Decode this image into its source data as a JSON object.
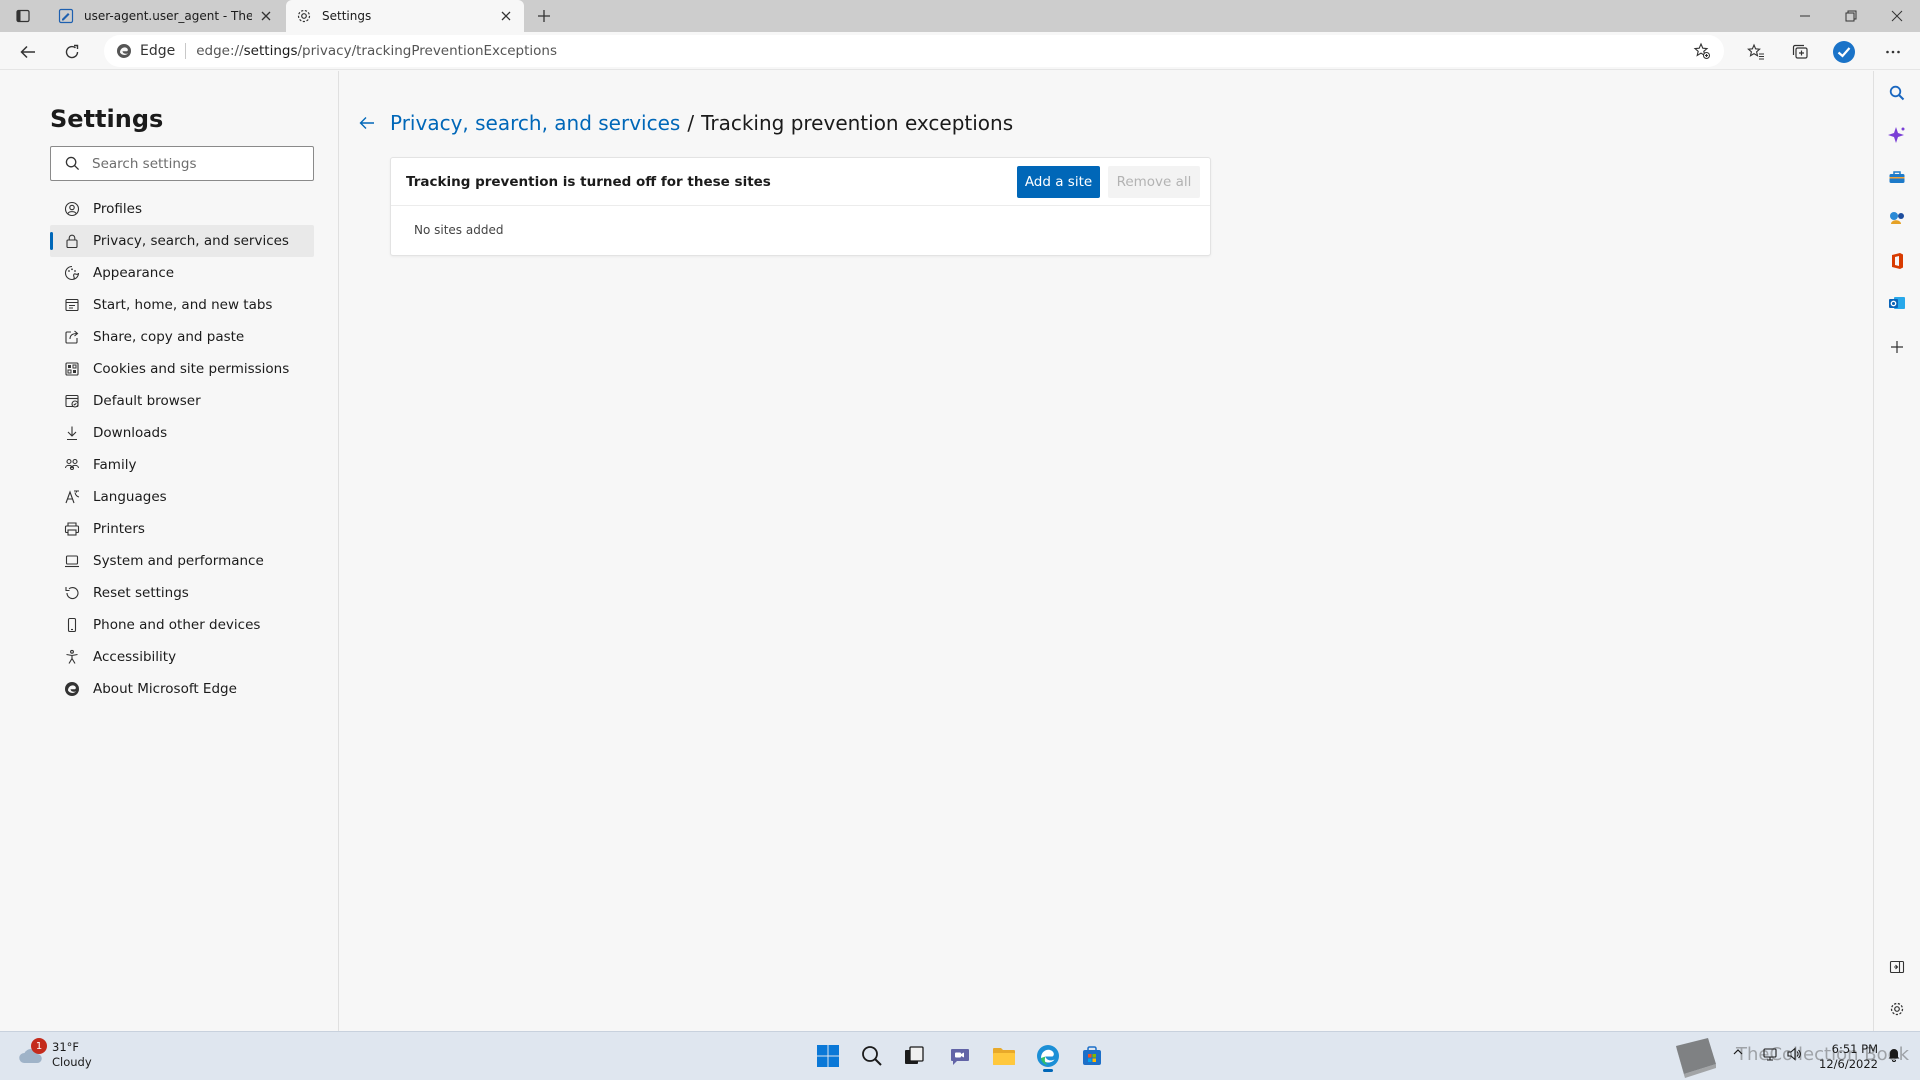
{
  "tabs": [
    {
      "title": "user-agent.user_agent - The Coll",
      "favicon": "edit-page-icon"
    },
    {
      "title": "Settings",
      "favicon": "gear-icon"
    }
  ],
  "toolbar": {
    "site_label": "Edge",
    "url_prefix": "edge://",
    "url_host": "settings",
    "url_path": "/privacy/trackingPreventionExceptions"
  },
  "sidebar": {
    "title": "Settings",
    "search_placeholder": "Search settings",
    "items": [
      {
        "label": "Profiles",
        "icon": "profile-icon"
      },
      {
        "label": "Privacy, search, and services",
        "icon": "lock-icon"
      },
      {
        "label": "Appearance",
        "icon": "appearance-icon"
      },
      {
        "label": "Start, home, and new tabs",
        "icon": "home-icon"
      },
      {
        "label": "Share, copy and paste",
        "icon": "share-icon"
      },
      {
        "label": "Cookies and site permissions",
        "icon": "cookies-icon"
      },
      {
        "label": "Default browser",
        "icon": "browser-icon"
      },
      {
        "label": "Downloads",
        "icon": "download-icon"
      },
      {
        "label": "Family",
        "icon": "family-icon"
      },
      {
        "label": "Languages",
        "icon": "language-icon"
      },
      {
        "label": "Printers",
        "icon": "printer-icon"
      },
      {
        "label": "System and performance",
        "icon": "laptop-icon"
      },
      {
        "label": "Reset settings",
        "icon": "reset-icon"
      },
      {
        "label": "Phone and other devices",
        "icon": "phone-icon"
      },
      {
        "label": "Accessibility",
        "icon": "accessibility-icon"
      },
      {
        "label": "About Microsoft Edge",
        "icon": "edge-logo-icon"
      }
    ],
    "active_index": 1
  },
  "main": {
    "breadcrumb_parent": "Privacy, search, and services",
    "breadcrumb_sep": "/",
    "breadcrumb_current": "Tracking prevention exceptions",
    "card_title": "Tracking prevention is turned off for these sites",
    "add_button": "Add a site",
    "remove_button": "Remove all",
    "empty_text": "No sites added"
  },
  "taskbar": {
    "weather_badge": "1",
    "weather_temp": "31°F",
    "weather_desc": "Cloudy",
    "time": "6:51 PM",
    "date": "12/6/2022",
    "watermark": "TheCollection Book"
  },
  "colors": {
    "accent": "#0067b8",
    "tabstrip": "#cdcdcd",
    "background": "#f7f7f7"
  }
}
